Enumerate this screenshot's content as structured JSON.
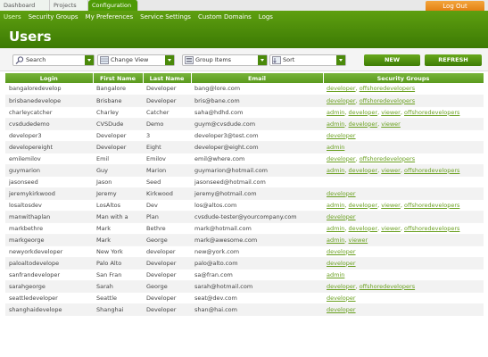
{
  "breadcrumbs": [
    "Dashboard",
    "Projects",
    "Configuration"
  ],
  "logout_label": "Log Out",
  "nav": [
    "Users",
    "Security Groups",
    "My Preferences",
    "Service Settings",
    "Custom Domains",
    "Logs"
  ],
  "page_title": "Users",
  "toolbar": {
    "search": "Search",
    "change_view": "Change View",
    "group_items": "Group Items",
    "sort": "Sort",
    "new": "NEW",
    "refresh": "REFRESH"
  },
  "colors": {
    "accent": "#4e9a06",
    "link": "#6aa020",
    "logout": "#e17b0c"
  },
  "table": {
    "columns": [
      "Login",
      "First Name",
      "Last Name",
      "Email",
      "Security Groups"
    ],
    "rows": [
      [
        "bangaloredevelop",
        "Bangalore",
        "Developer",
        "bang@lore.com",
        [
          "developer",
          "offshoredevelopers"
        ]
      ],
      [
        "brisbanedevelope",
        "Brisbane",
        "Developer",
        "bris@bane.com",
        [
          "developer",
          "offshoredevelopers"
        ]
      ],
      [
        "charleycatcher",
        "Charley",
        "Catcher",
        "saha@hdhd.com",
        [
          "admin",
          "developer",
          "viewer",
          "offshoredevelopers"
        ]
      ],
      [
        "cvsdudedemo",
        "CVSDude",
        "Demo",
        "guym@cvsdude.com",
        [
          "admin",
          "developer",
          "viewer"
        ]
      ],
      [
        "developer3",
        "Developer",
        "3",
        "developer3@test.com",
        [
          "developer"
        ]
      ],
      [
        "developereight",
        "Developer",
        "Eight",
        "developer@eight.com",
        [
          "admin"
        ]
      ],
      [
        "emilemilov",
        "Emil",
        "Emilov",
        "emil@where.com",
        [
          "developer",
          "offshoredevelopers"
        ]
      ],
      [
        "guymarion",
        "Guy",
        "Marion",
        "guymarion@hotmail.com",
        [
          "admin",
          "developer",
          "viewer",
          "offshoredevelopers"
        ]
      ],
      [
        "jasonseed",
        "Jason",
        "Seed",
        "jasonseed@hotmail.com",
        []
      ],
      [
        "jeremykirkwood",
        "Jeremy",
        "Kirkwood",
        "jeremy@hotmail.com",
        [
          "developer"
        ]
      ],
      [
        "losaltosdev",
        "LosAltos",
        "Dev",
        "los@altos.com",
        [
          "admin",
          "developer",
          "viewer",
          "offshoredevelopers"
        ]
      ],
      [
        "manwithaplan",
        "Man with a",
        "Plan",
        "cvsdude-tester@yourcompany.com",
        [
          "developer"
        ]
      ],
      [
        "markbethre",
        "Mark",
        "Bethre",
        "mark@hotmail.com",
        [
          "admin",
          "developer",
          "viewer",
          "offshoredevelopers"
        ]
      ],
      [
        "markgeorge",
        "Mark",
        "George",
        "mark@awesome.com",
        [
          "admin",
          "viewer"
        ]
      ],
      [
        "newyorkdeveloper",
        "New York",
        "developer",
        "new@york.com",
        [
          "developer"
        ]
      ],
      [
        "paloaltodevelope",
        "Palo Alto",
        "Developer",
        "palo@alto.com",
        [
          "developer"
        ]
      ],
      [
        "sanfrandeveloper",
        "San Fran",
        "Developer",
        "sa@fran.com",
        [
          "admin"
        ]
      ],
      [
        "sarahgeorge",
        "Sarah",
        "George",
        "sarah@hotmail.com",
        [
          "developer",
          "offshoredevelopers"
        ]
      ],
      [
        "seattledeveloper",
        "Seattle",
        "Developer",
        "seat@dev.com",
        [
          "developer"
        ]
      ],
      [
        "shanghaidevelope",
        "Shanghai",
        "Developer",
        "shan@hai.com",
        [
          "developer"
        ]
      ]
    ]
  }
}
